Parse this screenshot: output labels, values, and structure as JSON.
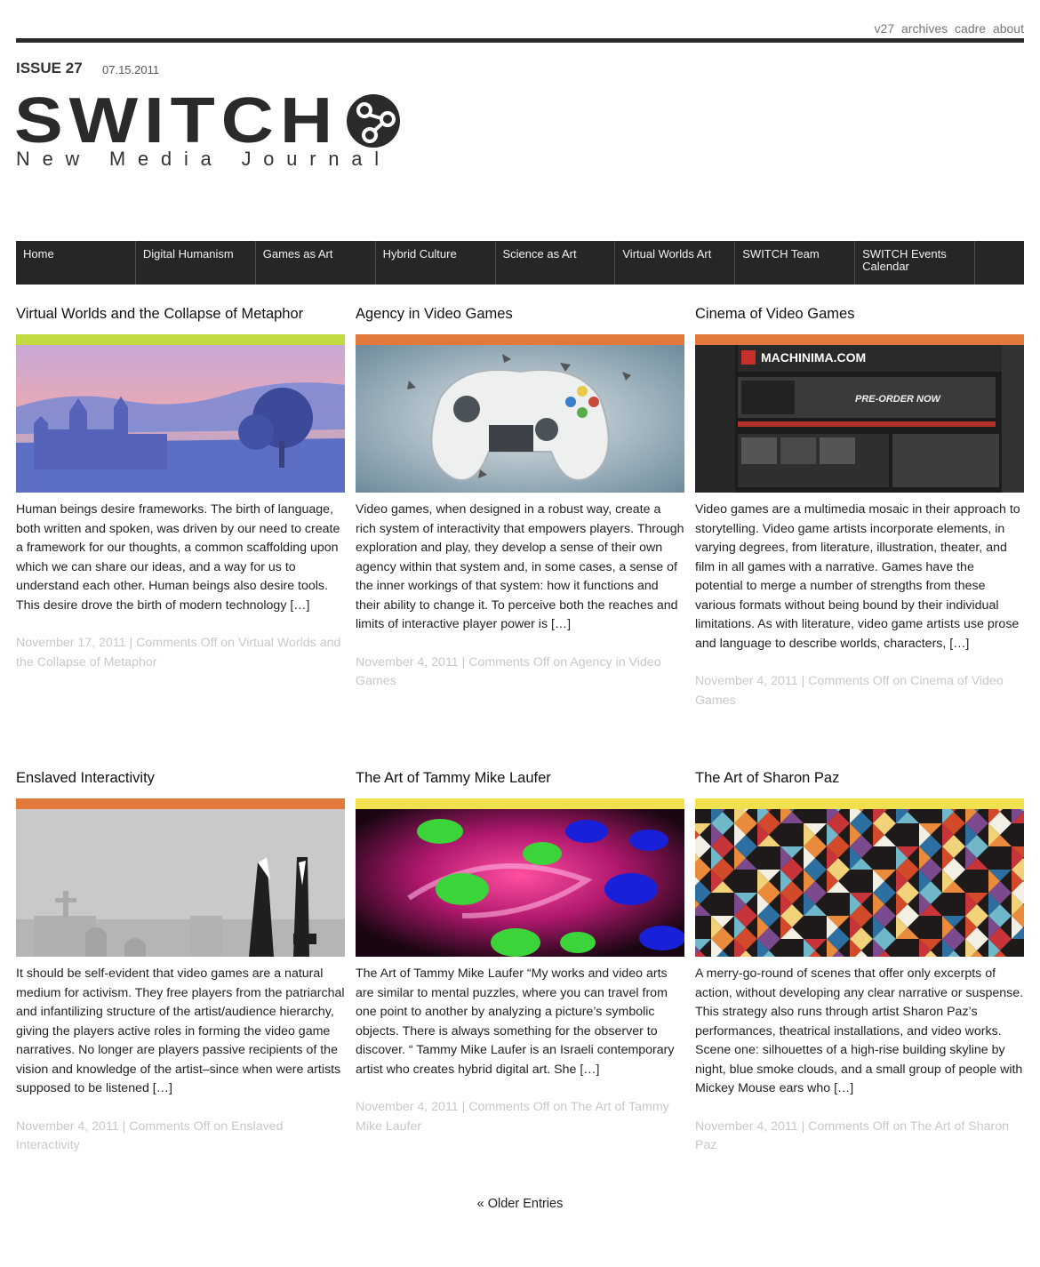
{
  "toplinks": [
    "v27",
    "archives",
    "cadre",
    "about"
  ],
  "issue": "ISSUE 27",
  "date": "07.15.2011",
  "logo": {
    "word": "SWITCH",
    "tagline": "New Media Journal"
  },
  "nav": [
    "Home",
    "Digital Humanism",
    "Games as Art",
    "Hybrid Culture",
    "Science as Art",
    "Virtual Worlds Art",
    "SWITCH Team",
    "SWITCH Events Calendar"
  ],
  "posts": [
    {
      "title": "Virtual Worlds and the Collapse of Metaphor",
      "accent": "#c2d93f",
      "excerpt": "Human beings desire frameworks. The birth of language, both written and spoken, was driven by our need to create a framework for our thoughts, a common scaffolding upon which we can share our ideas, and a way for us to understand each other. Human beings also desire tools. This desire drove the birth of modern technology […]",
      "meta": "November 17, 2011 | Comments Off on Virtual Worlds and the Collapse of Metaphor"
    },
    {
      "title": "Agency in Video Games",
      "accent": "#e2793a",
      "excerpt": "Video games, when designed in a robust way, create a rich system of interactivity that empowers players. Through exploration and play, they develop a sense of their own agency within that system and, in some cases, a sense of the inner workings of that system: how it functions and their ability to change it. To perceive both the reaches and limits of interactive player power is […]",
      "meta": "November 4, 2011 | Comments Off on Agency in Video Games"
    },
    {
      "title": "Cinema of Video Games",
      "accent": "#e2793a",
      "excerpt": "Video games are a multimedia mosaic in their approach to storytelling.  Video game artists incorporate elements, in varying degrees, from literature, illustration, theater, and film in all games with a narrative. Games have the potential to merge a number of strengths from these various formats without being bound by their individual limitations. As with literature, video game artists use prose and language to describe worlds, characters, […]",
      "meta": "November 4, 2011 | Comments Off on Cinema of Video Games",
      "image_text": {
        "brand": "MACHINIMA.COM",
        "preorder": "PRE-ORDER NOW"
      }
    },
    {
      "title": "Enslaved Interactivity",
      "accent": "#e2793a",
      "excerpt": "It should be self-evident that video games are a natural medium for activism. They free players from the patriarchal and infantilizing structure of the artist/audience hierarchy, giving the players active roles in forming the video game narratives. No longer are players passive recipients of the vision and knowledge of the artist–since when were artists supposed to be listened […]",
      "meta": "November 4, 2011 | Comments Off on Enslaved Interactivity"
    },
    {
      "title": "The Art of Tammy Mike Laufer",
      "accent": "#f2e14f",
      "excerpt": "The Art of Tammy Mike Laufer “My works and video arts are similar to mental puzzles, where you can travel from one point to another by analyzing a picture’s symbolic objects. There is always something for the observer to discover. “ Tammy Mike Laufer is an Israeli contemporary artist who creates hybrid digital art. She […]",
      "meta": "November 4, 2011 | Comments Off on The Art of Tammy Mike Laufer"
    },
    {
      "title": "The Art of Sharon Paz",
      "accent": "#f2e14f",
      "excerpt": "A merry-go-round of scenes that offer only excerpts of action, without developing any clear narrative or suspense. This strategy also runs through artist Sharon Paz’s performances, theatrical installations, and video works. Scene one: silhouettes of a high-rise building skyline by night, blue smoke clouds, and a small group of people with Mickey Mouse ears who […]",
      "meta": "November 4, 2011 | Comments Off on The Art of Sharon Paz"
    }
  ],
  "older_link": "« Older Entries"
}
